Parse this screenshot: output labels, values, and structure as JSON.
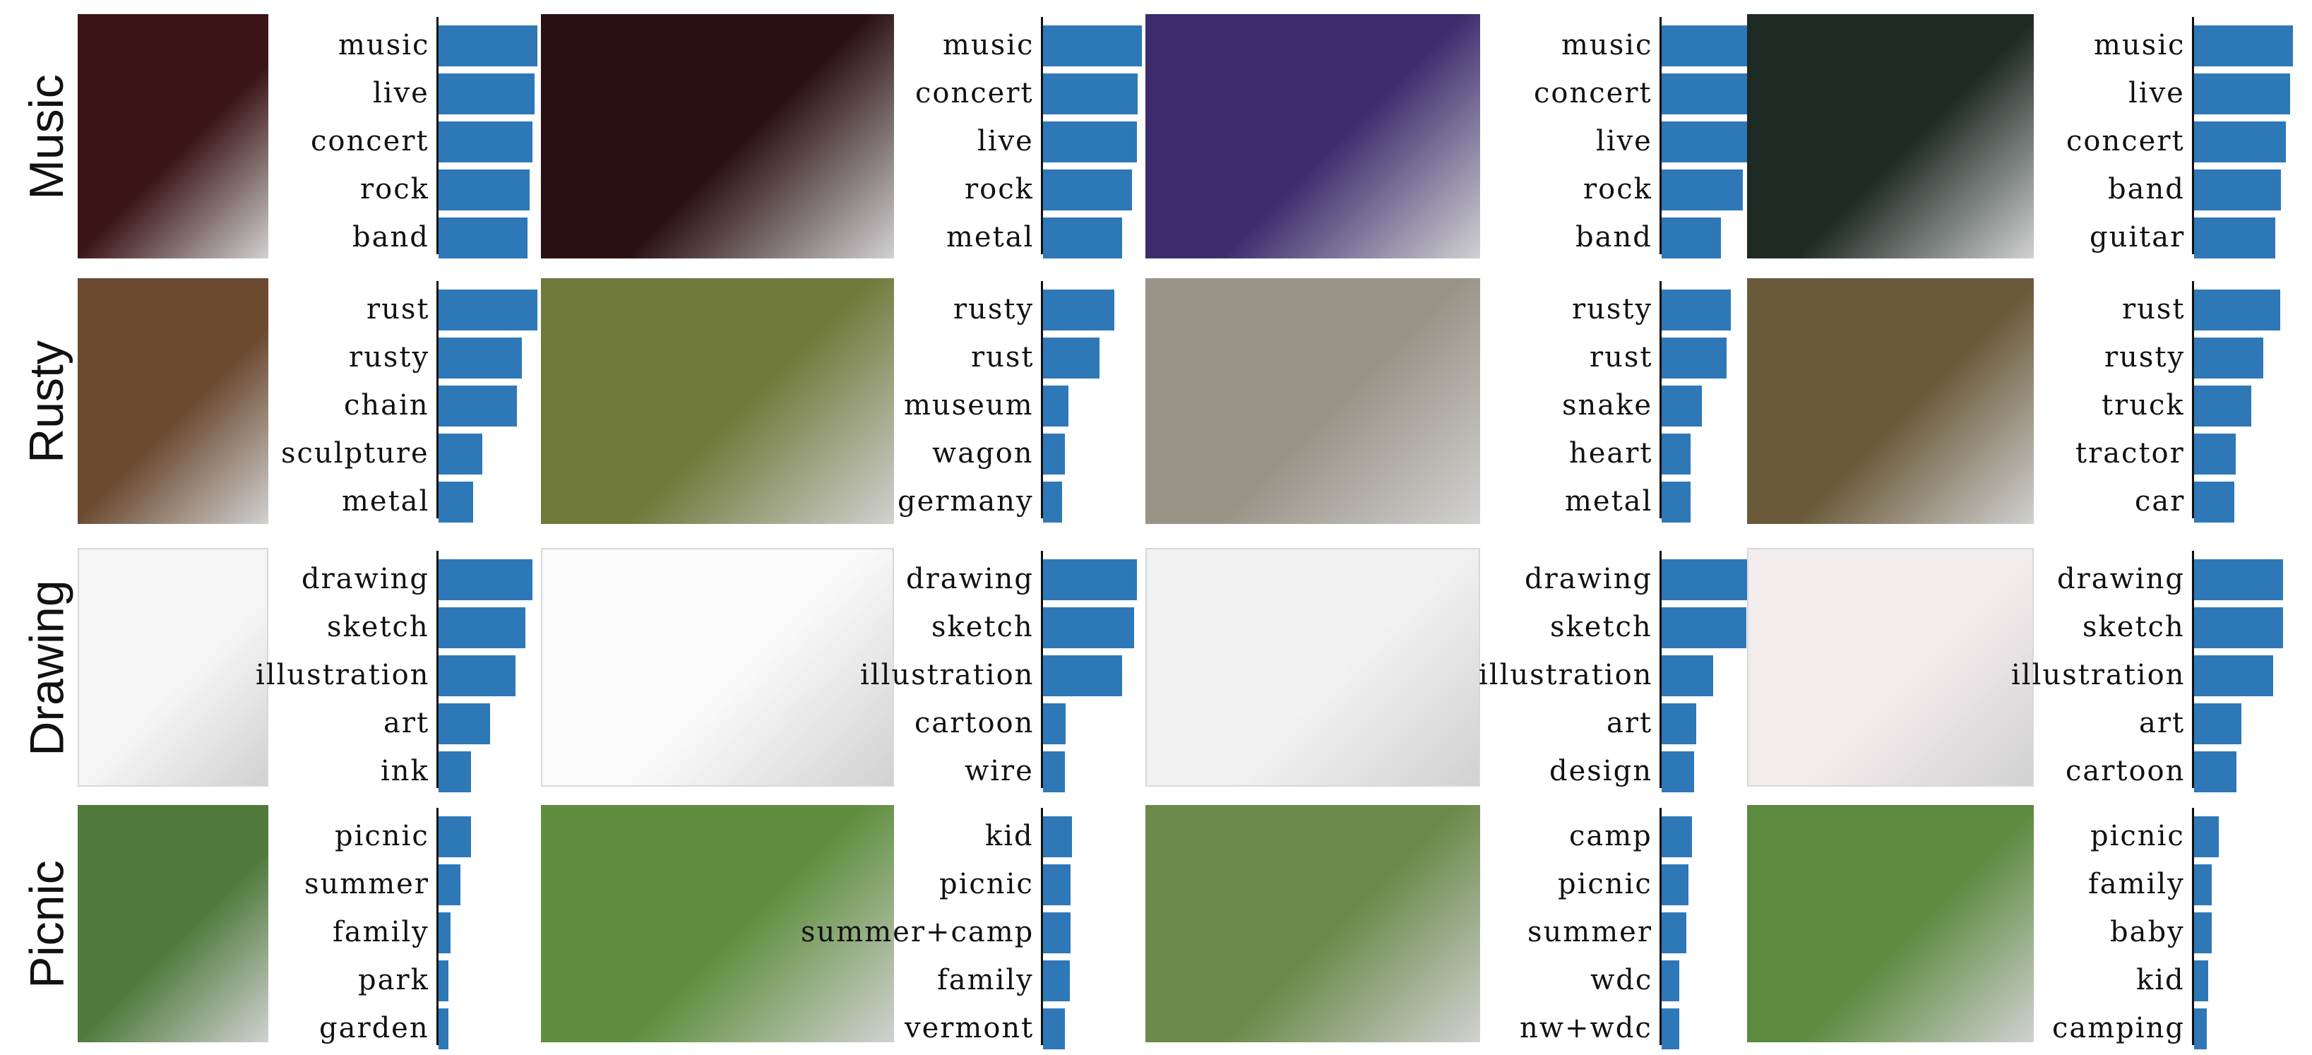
{
  "chart_data": {
    "type": "bar",
    "orientation": "horizontal",
    "colors": {
      "bar": "#2e78b8",
      "axis": "#111111"
    },
    "rows": [
      {
        "label": "Music",
        "panels": [
          {
            "image": "bass-guitarist-on-red-stage",
            "tags": [
              "music",
              "live",
              "concert",
              "rock",
              "band"
            ],
            "values": [
              1.0,
              0.97,
              0.95,
              0.92,
              0.9
            ]
          },
          {
            "image": "singer-with-drum-kit-on-stage",
            "tags": [
              "music",
              "concert",
              "live",
              "rock",
              "metal"
            ],
            "values": [
              1.0,
              0.96,
              0.95,
              0.9,
              0.8
            ]
          },
          {
            "image": "musician-with-mandolin-purple-light",
            "tags": [
              "music",
              "concert",
              "live",
              "rock",
              "band"
            ],
            "values": [
              1.0,
              0.97,
              0.95,
              0.82,
              0.6
            ]
          },
          {
            "image": "guitarist-singing-into-microphone",
            "tags": [
              "music",
              "live",
              "concert",
              "band",
              "guitar"
            ],
            "values": [
              1.0,
              0.97,
              0.93,
              0.88,
              0.82
            ]
          }
        ]
      },
      {
        "label": "Rusty",
        "panels": [
          {
            "image": "rusty-hook-and-chain",
            "tags": [
              "rust",
              "rusty",
              "chain",
              "sculpture",
              "metal"
            ],
            "values": [
              1.0,
              0.84,
              0.79,
              0.44,
              0.35
            ]
          },
          {
            "image": "rusty-plough-in-grass",
            "tags": [
              "rusty",
              "rust",
              "museum",
              "wagon",
              "germany"
            ],
            "values": [
              0.72,
              0.57,
              0.26,
              0.22,
              0.19
            ]
          },
          {
            "image": "rusty-pipe-end-closeup",
            "tags": [
              "rusty",
              "rust",
              "snake",
              "heart",
              "metal"
            ],
            "values": [
              0.7,
              0.66,
              0.41,
              0.29,
              0.29
            ]
          },
          {
            "image": "rusty-old-truck",
            "tags": [
              "rust",
              "rusty",
              "truck",
              "tractor",
              "car"
            ],
            "values": [
              0.87,
              0.7,
              0.58,
              0.42,
              0.41
            ]
          }
        ]
      },
      {
        "label": "Drawing",
        "panels": [
          {
            "image": "caricature-of-woman",
            "tags": [
              "drawing",
              "sketch",
              "illustration",
              "art",
              "ink"
            ],
            "values": [
              0.95,
              0.88,
              0.78,
              0.52,
              0.33
            ]
          },
          {
            "image": "sketch-of-dog-with-goggles",
            "tags": [
              "drawing",
              "sketch",
              "illustration",
              "cartoon",
              "wire"
            ],
            "values": [
              0.95,
              0.92,
              0.8,
              0.23,
              0.22
            ]
          },
          {
            "image": "sketch-of-two-kids-with-heart",
            "tags": [
              "drawing",
              "sketch",
              "illustration",
              "art",
              "design"
            ],
            "values": [
              0.9,
              0.86,
              0.52,
              0.35,
              0.33
            ]
          },
          {
            "image": "sketch-of-woman-with-speech-bubble",
            "tags": [
              "drawing",
              "sketch",
              "illustration",
              "art",
              "cartoon"
            ],
            "values": [
              0.9,
              0.9,
              0.8,
              0.48,
              0.43
            ]
          }
        ]
      },
      {
        "label": "Picnic",
        "panels": [
          {
            "image": "crowd-picnic-in-park",
            "tags": [
              "picnic",
              "summer",
              "family",
              "park",
              "garden"
            ],
            "values": [
              0.33,
              0.22,
              0.12,
              0.1,
              0.1
            ]
          },
          {
            "image": "man-standing-on-grassy-hill",
            "tags": [
              "kid",
              "picnic",
              "summer+camp",
              "family",
              "vermont"
            ],
            "values": [
              0.29,
              0.28,
              0.28,
              0.27,
              0.22
            ]
          },
          {
            "image": "woman-at-outdoor-picnic",
            "tags": [
              "camp",
              "picnic",
              "summer",
              "wdc",
              "nw+wdc"
            ],
            "values": [
              0.31,
              0.27,
              0.25,
              0.18,
              0.18
            ]
          },
          {
            "image": "children-on-picnic-blanket",
            "tags": [
              "picnic",
              "family",
              "baby",
              "kid",
              "camping"
            ],
            "values": [
              0.25,
              0.18,
              0.18,
              0.14,
              0.13
            ]
          }
        ]
      }
    ]
  }
}
